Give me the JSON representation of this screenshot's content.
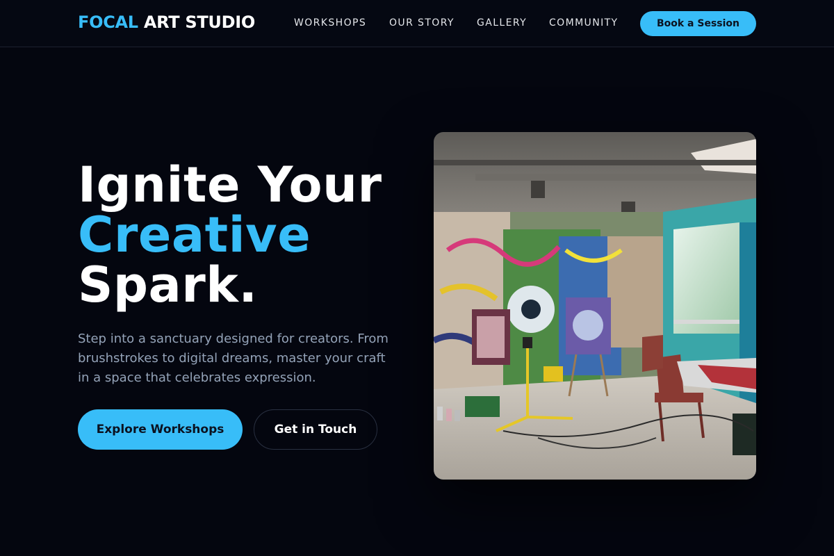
{
  "brand": {
    "accent": "FOCAL",
    "rest": "ART STUDIO"
  },
  "nav": {
    "links": [
      "WORKSHOPS",
      "OUR STORY",
      "GALLERY",
      "COMMUNITY"
    ],
    "cta": "Book a Session"
  },
  "hero": {
    "title_line1": "Ignite Your",
    "title_line2": "Creative",
    "title_line3": "Spark.",
    "description": "Step into a sanctuary designed for creators. From brushstrokes to digital dreams, master your craft in a space that celebrates expression.",
    "primary_button": "Explore Workshops",
    "secondary_button": "Get in Touch"
  },
  "colors": {
    "background": "#04060f",
    "accent": "#38bdf8",
    "muted_text": "#94a3b8"
  }
}
